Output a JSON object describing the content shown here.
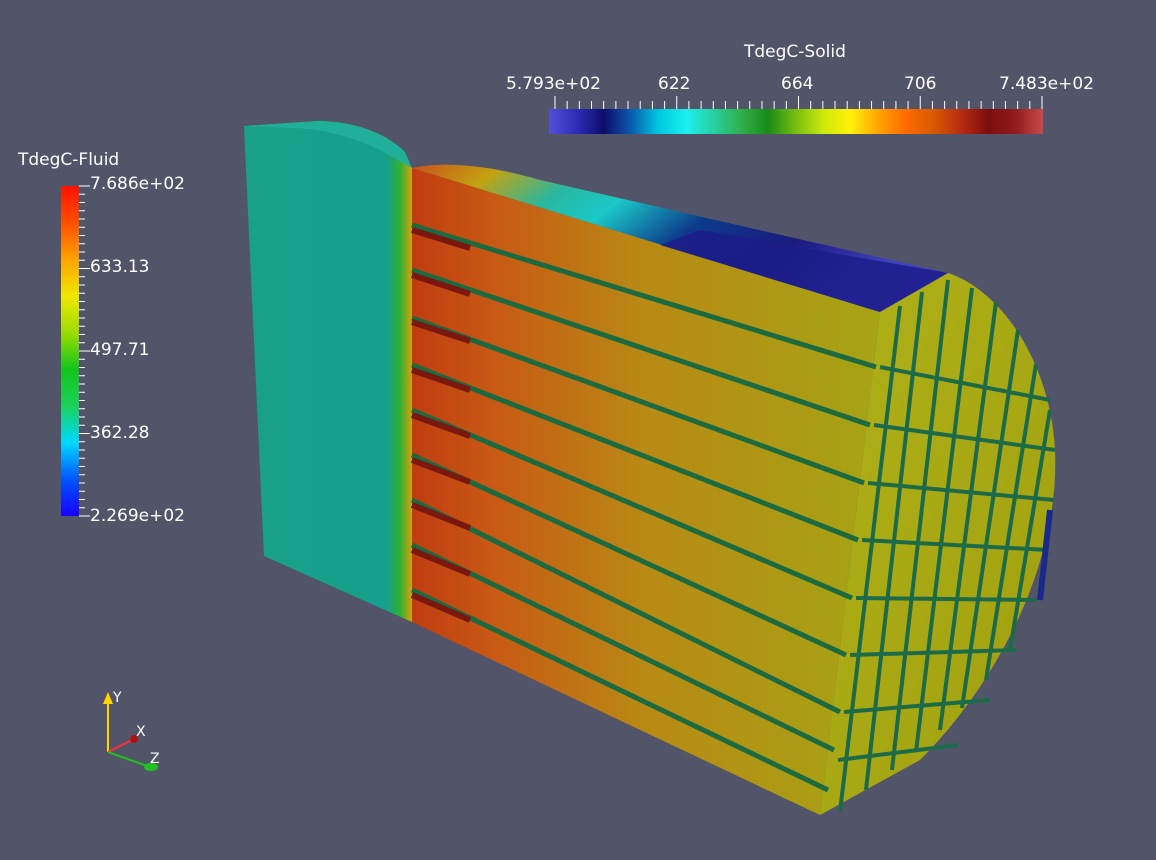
{
  "scalar_bars": {
    "fluid": {
      "title": "TdegC-Fluid",
      "labels": [
        "7.686e+02",
        "633.13",
        "497.71",
        "362.28",
        "2.269e+02"
      ],
      "colormap": [
        "#1700ff",
        "#0055ff",
        "#00d8ff",
        "#1bd25a",
        "#12c41c",
        "#9ddc00",
        "#f0e800",
        "#ffa200",
        "#ff4f00",
        "#ff1100"
      ]
    },
    "solid": {
      "title": "TdegC-Solid",
      "labels": [
        "5.793e+02",
        "622",
        "664",
        "706",
        "7.483e+02"
      ],
      "colormap": [
        "#5050d8",
        "#2d2db8",
        "#0d0d6a",
        "#0a5cb0",
        "#00c8e0",
        "#1cf0f0",
        "#27d0a0",
        "#2eb04a",
        "#198a18",
        "#78be10",
        "#cdea0a",
        "#fff00a",
        "#ffa400",
        "#ff6a00",
        "#d85a00",
        "#b82d12",
        "#7d0d0d",
        "#901c1c",
        "#c84a4a"
      ]
    }
  },
  "orientation_axes": {
    "labels": [
      "Y",
      "X",
      "Z"
    ],
    "colors": {
      "y": "#ffd400",
      "x": "#ff3030",
      "z": "#20c020"
    }
  },
  "colors": {
    "background": "#525569",
    "inlet_face": "#14a08c",
    "fluid_hot": "#c84a12",
    "solid_face": "#a8a812",
    "cold_edge": "#1a2a8a",
    "channel_line": "#186a48"
  }
}
